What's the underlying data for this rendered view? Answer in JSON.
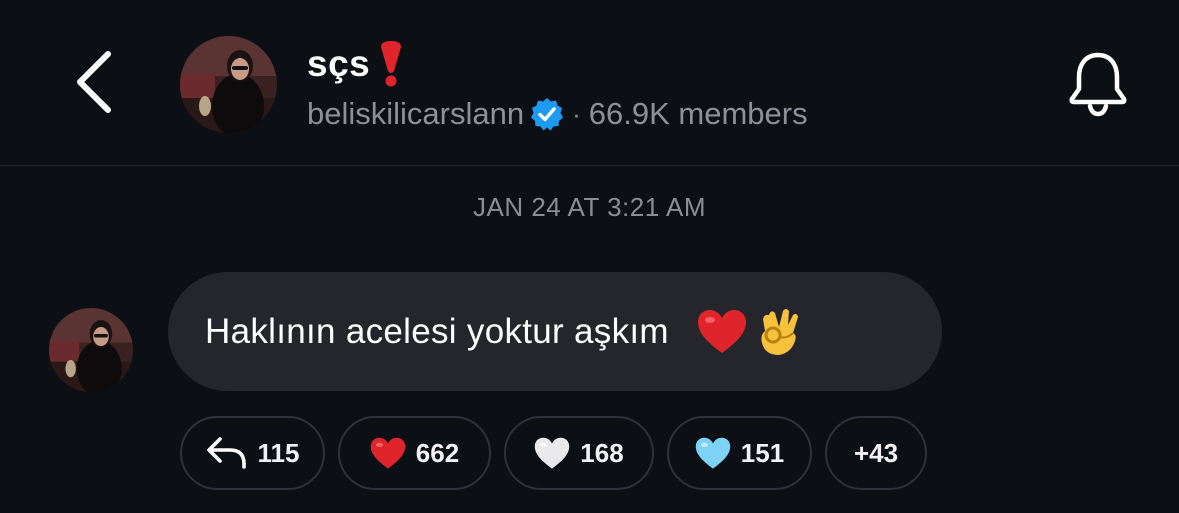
{
  "header": {
    "title": "sçs",
    "title_emoji": "heavy-red-exclamation",
    "username": "beliskilicarslann",
    "separator": "·",
    "members": "66.9K members",
    "verified_color": "#1d9bf0"
  },
  "message": {
    "timestamp": "JAN 24 AT 3:21 AM",
    "text": "Haklının acelesi yoktur aşkım",
    "emojis": [
      "red-heart",
      "ok-hand"
    ]
  },
  "reactions": [
    {
      "icon": "reply-icon",
      "count": "115"
    },
    {
      "icon": "red-heart-icon",
      "count": "662"
    },
    {
      "icon": "white-heart-icon",
      "count": "168"
    },
    {
      "icon": "light-blue-heart-icon",
      "count": "151"
    },
    {
      "more": "+43"
    }
  ],
  "colors": {
    "background": "#0c0f14",
    "bubble": "#25262b",
    "muted_text": "#8e9099",
    "red_heart": "#e0242c",
    "blue_heart": "#7dd3f5"
  }
}
